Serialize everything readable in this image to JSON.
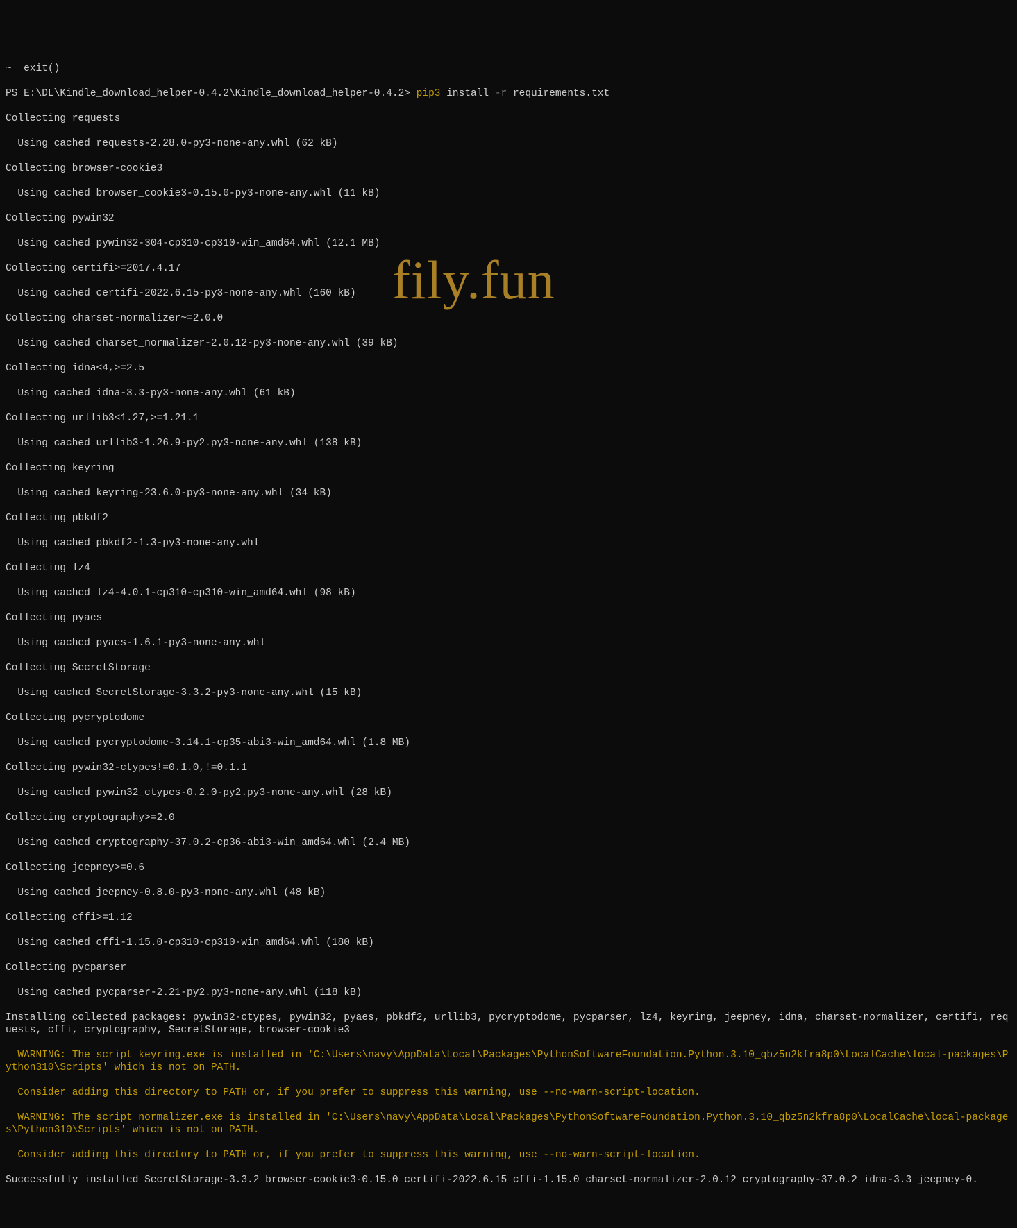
{
  "line0": "~  exit()",
  "prompt": {
    "ps": "PS E:\\DL\\Kindle_download_helper-0.4.2\\Kindle_download_helper-0.4.2> ",
    "command": "pip3",
    "args_install": " install ",
    "args_flag": "-r",
    "args_file": " requirements.txt"
  },
  "lines": [
    "Collecting requests",
    "  Using cached requests-2.28.0-py3-none-any.whl (62 kB)",
    "Collecting browser-cookie3",
    "  Using cached browser_cookie3-0.15.0-py3-none-any.whl (11 kB)",
    "Collecting pywin32",
    "  Using cached pywin32-304-cp310-cp310-win_amd64.whl (12.1 MB)",
    "Collecting certifi>=2017.4.17",
    "  Using cached certifi-2022.6.15-py3-none-any.whl (160 kB)",
    "Collecting charset-normalizer~=2.0.0",
    "  Using cached charset_normalizer-2.0.12-py3-none-any.whl (39 kB)",
    "Collecting idna<4,>=2.5",
    "  Using cached idna-3.3-py3-none-any.whl (61 kB)",
    "Collecting urllib3<1.27,>=1.21.1",
    "  Using cached urllib3-1.26.9-py2.py3-none-any.whl (138 kB)",
    "Collecting keyring",
    "  Using cached keyring-23.6.0-py3-none-any.whl (34 kB)",
    "Collecting pbkdf2",
    "  Using cached pbkdf2-1.3-py3-none-any.whl",
    "Collecting lz4",
    "  Using cached lz4-4.0.1-cp310-cp310-win_amd64.whl (98 kB)",
    "Collecting pyaes",
    "  Using cached pyaes-1.6.1-py3-none-any.whl",
    "Collecting SecretStorage",
    "  Using cached SecretStorage-3.3.2-py3-none-any.whl (15 kB)",
    "Collecting pycryptodome",
    "  Using cached pycryptodome-3.14.1-cp35-abi3-win_amd64.whl (1.8 MB)",
    "Collecting pywin32-ctypes!=0.1.0,!=0.1.1",
    "  Using cached pywin32_ctypes-0.2.0-py2.py3-none-any.whl (28 kB)",
    "Collecting cryptography>=2.0",
    "  Using cached cryptography-37.0.2-cp36-abi3-win_amd64.whl (2.4 MB)",
    "Collecting jeepney>=0.6",
    "  Using cached jeepney-0.8.0-py3-none-any.whl (48 kB)",
    "Collecting cffi>=1.12",
    "  Using cached cffi-1.15.0-cp310-cp310-win_amd64.whl (180 kB)",
    "Collecting pycparser",
    "  Using cached pycparser-2.21-py2.py3-none-any.whl (118 kB)",
    "Installing collected packages: pywin32-ctypes, pywin32, pyaes, pbkdf2, urllib3, pycryptodome, pycparser, lz4, keyring, jeepney, idna, charset-normalizer, certifi, requests, cffi, cryptography, SecretStorage, browser-cookie3"
  ],
  "warnings": [
    "  WARNING: The script keyring.exe is installed in 'C:\\Users\\navy\\AppData\\Local\\Packages\\PythonSoftwareFoundation.Python.3.10_qbz5n2kfra8p0\\LocalCache\\local-packages\\Python310\\Scripts' which is not on PATH.",
    "  Consider adding this directory to PATH or, if you prefer to suppress this warning, use --no-warn-script-location.",
    "  WARNING: The script normalizer.exe is installed in 'C:\\Users\\navy\\AppData\\Local\\Packages\\PythonSoftwareFoundation.Python.3.10_qbz5n2kfra8p0\\LocalCache\\local-packages\\Python310\\Scripts' which is not on PATH.",
    "  Consider adding this directory to PATH or, if you prefer to suppress this warning, use --no-warn-script-location."
  ],
  "success": "Successfully installed SecretStorage-3.3.2 browser-cookie3-0.15.0 certifi-2022.6.15 cffi-1.15.0 charset-normalizer-2.0.12 cryptography-37.0.2 idna-3.3 jeepney-0.",
  "watermark": "fily.fun"
}
